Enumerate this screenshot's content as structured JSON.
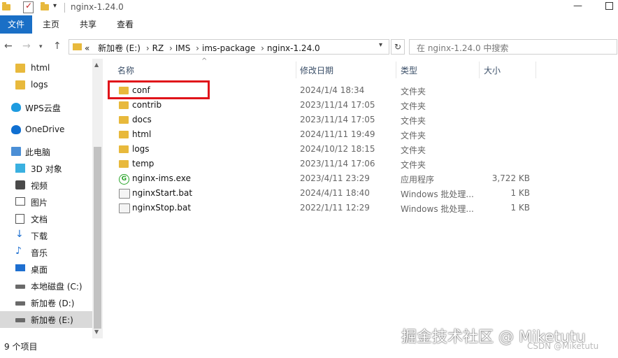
{
  "window": {
    "title": "nginx-1.24.0"
  },
  "ribbon": {
    "tabs": [
      "文件",
      "主页",
      "共享",
      "查看"
    ]
  },
  "address": {
    "path": [
      "RZ",
      "IMS",
      "ims-package",
      "nginx-1.24.0"
    ],
    "drive": "新加卷 (E:)",
    "overflow": "«",
    "search_placeholder": "在 nginx-1.24.0 中搜索"
  },
  "nav": {
    "items": [
      {
        "label": "html",
        "icon": "folder-icon"
      },
      {
        "label": "logs",
        "icon": "folder-icon"
      },
      {
        "label": "WPS云盘",
        "icon": "cloud-icon"
      },
      {
        "label": "OneDrive",
        "icon": "onedrive-icon"
      },
      {
        "label": "此电脑",
        "icon": "computer-icon"
      },
      {
        "label": "3D 对象",
        "icon": "cube-icon"
      },
      {
        "label": "视频",
        "icon": "video-icon"
      },
      {
        "label": "图片",
        "icon": "picture-icon"
      },
      {
        "label": "文档",
        "icon": "document-icon"
      },
      {
        "label": "下载",
        "icon": "download-icon"
      },
      {
        "label": "音乐",
        "icon": "music-icon"
      },
      {
        "label": "桌面",
        "icon": "desktop-icon"
      },
      {
        "label": "本地磁盘 (C:)",
        "icon": "drive-icon"
      },
      {
        "label": "新加卷 (D:)",
        "icon": "drive-icon"
      },
      {
        "label": "新加卷 (E:)",
        "icon": "drive-icon",
        "selected": true
      }
    ]
  },
  "list": {
    "columns": {
      "name": "名称",
      "date": "修改日期",
      "type": "类型",
      "size": "大小"
    },
    "rows": [
      {
        "name": "conf",
        "date": "2024/1/4 18:34",
        "type": "文件夹",
        "size": "",
        "icon": "folder-icon"
      },
      {
        "name": "contrib",
        "date": "2023/11/14 17:05",
        "type": "文件夹",
        "size": "",
        "icon": "folder-icon"
      },
      {
        "name": "docs",
        "date": "2023/11/14 17:05",
        "type": "文件夹",
        "size": "",
        "icon": "folder-icon"
      },
      {
        "name": "html",
        "date": "2024/11/11 19:49",
        "type": "文件夹",
        "size": "",
        "icon": "folder-icon"
      },
      {
        "name": "logs",
        "date": "2024/10/12 18:15",
        "type": "文件夹",
        "size": "",
        "icon": "folder-icon"
      },
      {
        "name": "temp",
        "date": "2023/11/14 17:06",
        "type": "文件夹",
        "size": "",
        "icon": "folder-icon"
      },
      {
        "name": "nginx-ims.exe",
        "date": "2023/4/11 23:29",
        "type": "应用程序",
        "size": "3,722 KB",
        "icon": "exe-icon"
      },
      {
        "name": "nginxStart.bat",
        "date": "2024/4/11 18:40",
        "type": "Windows 批处理...",
        "size": "1 KB",
        "icon": "bat-icon"
      },
      {
        "name": "nginxStop.bat",
        "date": "2022/1/11 12:29",
        "type": "Windows 批处理...",
        "size": "1 KB",
        "icon": "bat-icon"
      }
    ]
  },
  "status": {
    "text": "9 个项目"
  },
  "watermark": {
    "main": "掘金技术社区 @ Miketutu",
    "sub": "CSDN @Miketutu"
  }
}
